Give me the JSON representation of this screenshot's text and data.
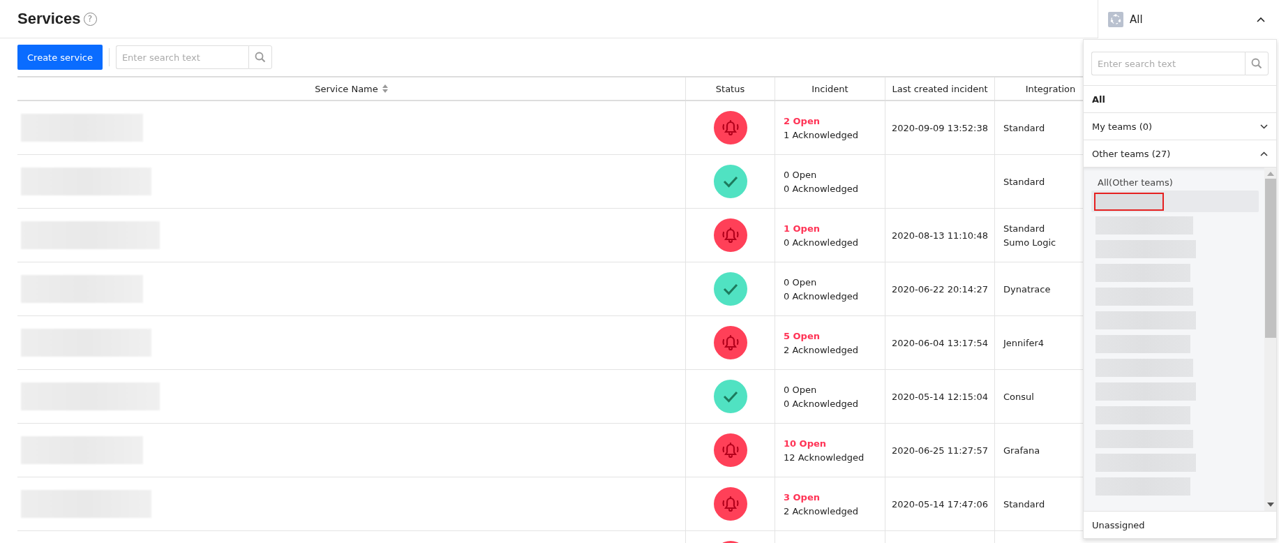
{
  "page": {
    "title": "Services",
    "help_icon": "?",
    "create_button": "Create service",
    "search": {
      "placeholder": "Enter search text"
    }
  },
  "table": {
    "columns": [
      "Service Name",
      "Status",
      "Incident",
      "Last created incident",
      "Integration"
    ],
    "rows": [
      {
        "kind": "alert",
        "open": "2 Open",
        "acknowledged": "1 Acknowledged",
        "last_incident": "2020-09-09 13:52:38",
        "integrations": [
          "Standard"
        ]
      },
      {
        "kind": "ok",
        "open": "0 Open",
        "acknowledged": "0 Acknowledged",
        "integrations": [
          "Standard"
        ]
      },
      {
        "kind": "alert",
        "open": "1 Open",
        "acknowledged": "0 Acknowledged",
        "last_incident": "2020-08-13 11:10:48",
        "integrations": [
          "Standard",
          "Sumo Logic"
        ]
      },
      {
        "kind": "ok",
        "open": "0 Open",
        "acknowledged": "0 Acknowledged",
        "last_incident": "2020-06-22 20:14:27",
        "integrations": [
          "Dynatrace"
        ]
      },
      {
        "kind": "alert",
        "open": "5 Open",
        "acknowledged": "2 Acknowledged",
        "last_incident": "2020-06-04 13:17:54",
        "integrations": [
          "Jennifer4"
        ]
      },
      {
        "kind": "ok",
        "open": "0 Open",
        "acknowledged": "0 Acknowledged",
        "last_incident": "2020-05-14 12:15:04",
        "integrations": [
          "Consul"
        ]
      },
      {
        "kind": "alert",
        "open": "10 Open",
        "acknowledged": "12 Acknowledged",
        "last_incident": "2020-06-25 11:27:57",
        "integrations": [
          "Grafana"
        ]
      },
      {
        "kind": "alert",
        "open": "3 Open",
        "acknowledged": "2 Acknowledged",
        "last_incident": "2020-05-14 17:47:06",
        "integrations": [
          "Standard"
        ]
      },
      {
        "kind": "alert"
      }
    ]
  },
  "team_filter": {
    "value": "All",
    "expanded": true,
    "search": {
      "placeholder": "Enter search text"
    },
    "all": "All",
    "groups": [
      {
        "label": "My teams (0)",
        "expanded": false
      },
      {
        "label": "Other teams (27)",
        "expanded": true,
        "all_label": "All(Other teams)",
        "items": [
          {
            "selected": true
          },
          {
            "selected": false
          },
          {
            "selected": false
          },
          {
            "selected": false
          },
          {
            "selected": false
          },
          {
            "selected": false
          },
          {
            "selected": false
          },
          {
            "selected": false
          },
          {
            "selected": false
          },
          {
            "selected": false
          },
          {
            "selected": false
          },
          {
            "selected": false
          },
          {
            "selected": false
          }
        ]
      }
    ],
    "unassigned": "Unassigned"
  }
}
